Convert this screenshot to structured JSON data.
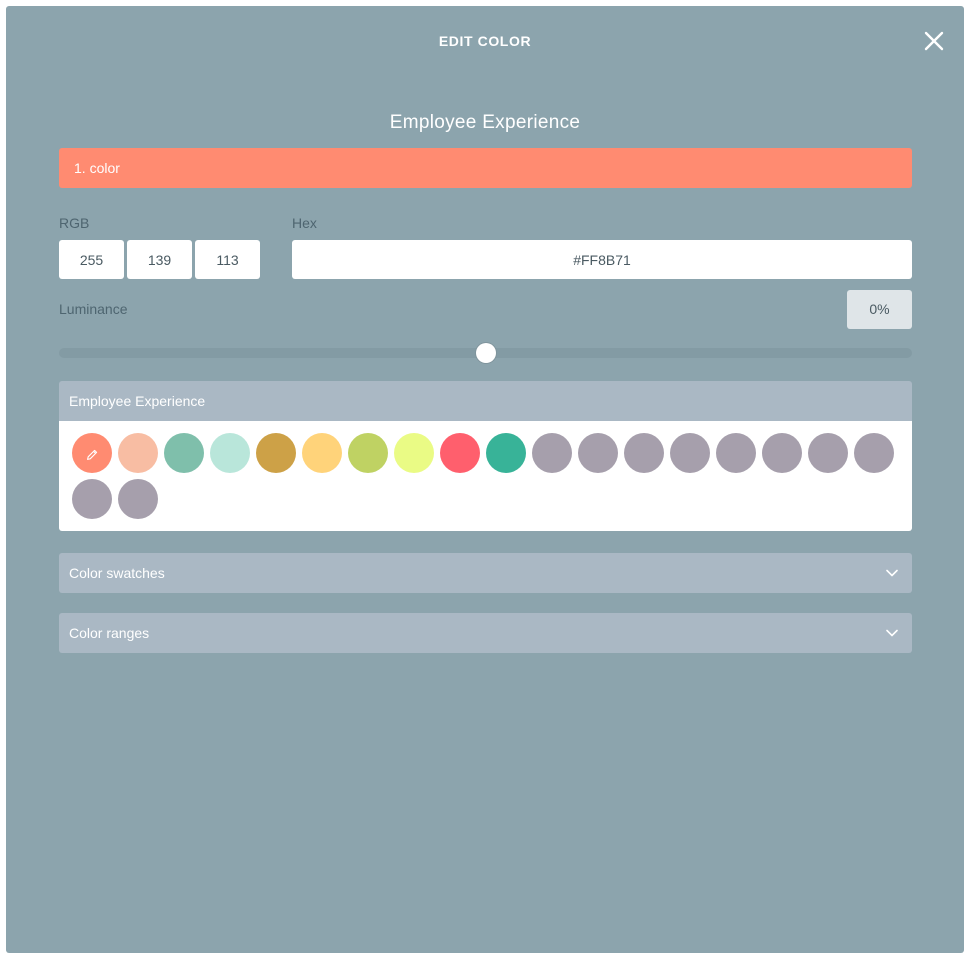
{
  "modal": {
    "title": "EDIT COLOR"
  },
  "palette": {
    "name": "Employee Experience"
  },
  "current_color": {
    "label": "1. color",
    "hex_color": "#FF8B71"
  },
  "rgb": {
    "label": "RGB",
    "r": "255",
    "g": "139",
    "b": "113"
  },
  "hex": {
    "label": "Hex",
    "value": "#FF8B71"
  },
  "luminance": {
    "label": "Luminance",
    "value": "0%",
    "slider_fraction": 0.5
  },
  "palette_panel": {
    "title": "Employee Experience",
    "swatches": [
      {
        "color": "#ff8b71",
        "selected": true,
        "icon": "pencil-icon"
      },
      {
        "color": "#f8bda3"
      },
      {
        "color": "#7fbfab"
      },
      {
        "color": "#b9e6da"
      },
      {
        "color": "#cda147"
      },
      {
        "color": "#ffd37a"
      },
      {
        "color": "#bfd263"
      },
      {
        "color": "#eafb85"
      },
      {
        "color": "#ff5f6d"
      },
      {
        "color": "#38b398"
      },
      {
        "color": "#a69fac"
      },
      {
        "color": "#a69fac"
      },
      {
        "color": "#a69fac"
      },
      {
        "color": "#a69fac"
      },
      {
        "color": "#a69fac"
      },
      {
        "color": "#a69fac"
      },
      {
        "color": "#a69fac"
      },
      {
        "color": "#a69fac"
      },
      {
        "color": "#a69fac"
      },
      {
        "color": "#a69fac"
      }
    ]
  },
  "color_swatches_panel": {
    "title": "Color swatches",
    "icon": "chevron-down-icon"
  },
  "color_ranges_panel": {
    "title": "Color ranges",
    "icon": "chevron-down-icon"
  },
  "colors": {
    "modal_bg": "#8ca4ad",
    "panel_header_bg": "#aab8c4"
  }
}
